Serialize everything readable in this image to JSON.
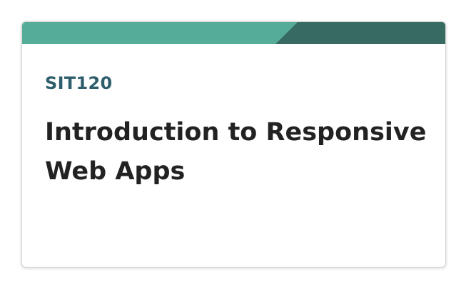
{
  "card": {
    "unit_code": "SIT120",
    "unit_title": "Introduction to Responsive Web Apps"
  },
  "colors": {
    "banner_light": "#55ad98",
    "banner_dark": "#376b61",
    "unit_code": "#2e5d6b",
    "title": "#222222"
  }
}
